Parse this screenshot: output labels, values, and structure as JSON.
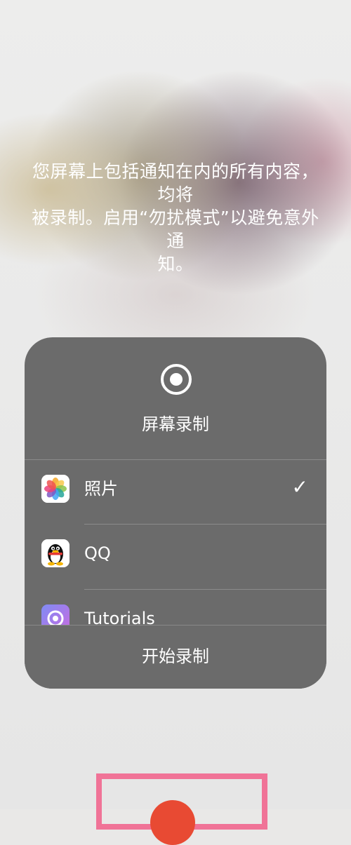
{
  "warning_lines": [
    "您屏幕上包括通知在内的所有内容，均将",
    "被录制。启用“勿扰模式”以避免意外通",
    "知。"
  ],
  "panel": {
    "title": "屏幕录制",
    "apps": [
      {
        "label": "照片",
        "icon": "photos-icon",
        "selected": true,
        "check": "✓"
      },
      {
        "label": "QQ",
        "icon": "qq-penguin-icon",
        "selected": false
      },
      {
        "label": "Tutorials",
        "icon": "tutorials-icon",
        "selected": false
      }
    ],
    "start_label": "开始录制"
  },
  "colors": {
    "panel_bg": "#6b6b6b",
    "highlight": "#f07397",
    "record_button": "#e84a33"
  }
}
